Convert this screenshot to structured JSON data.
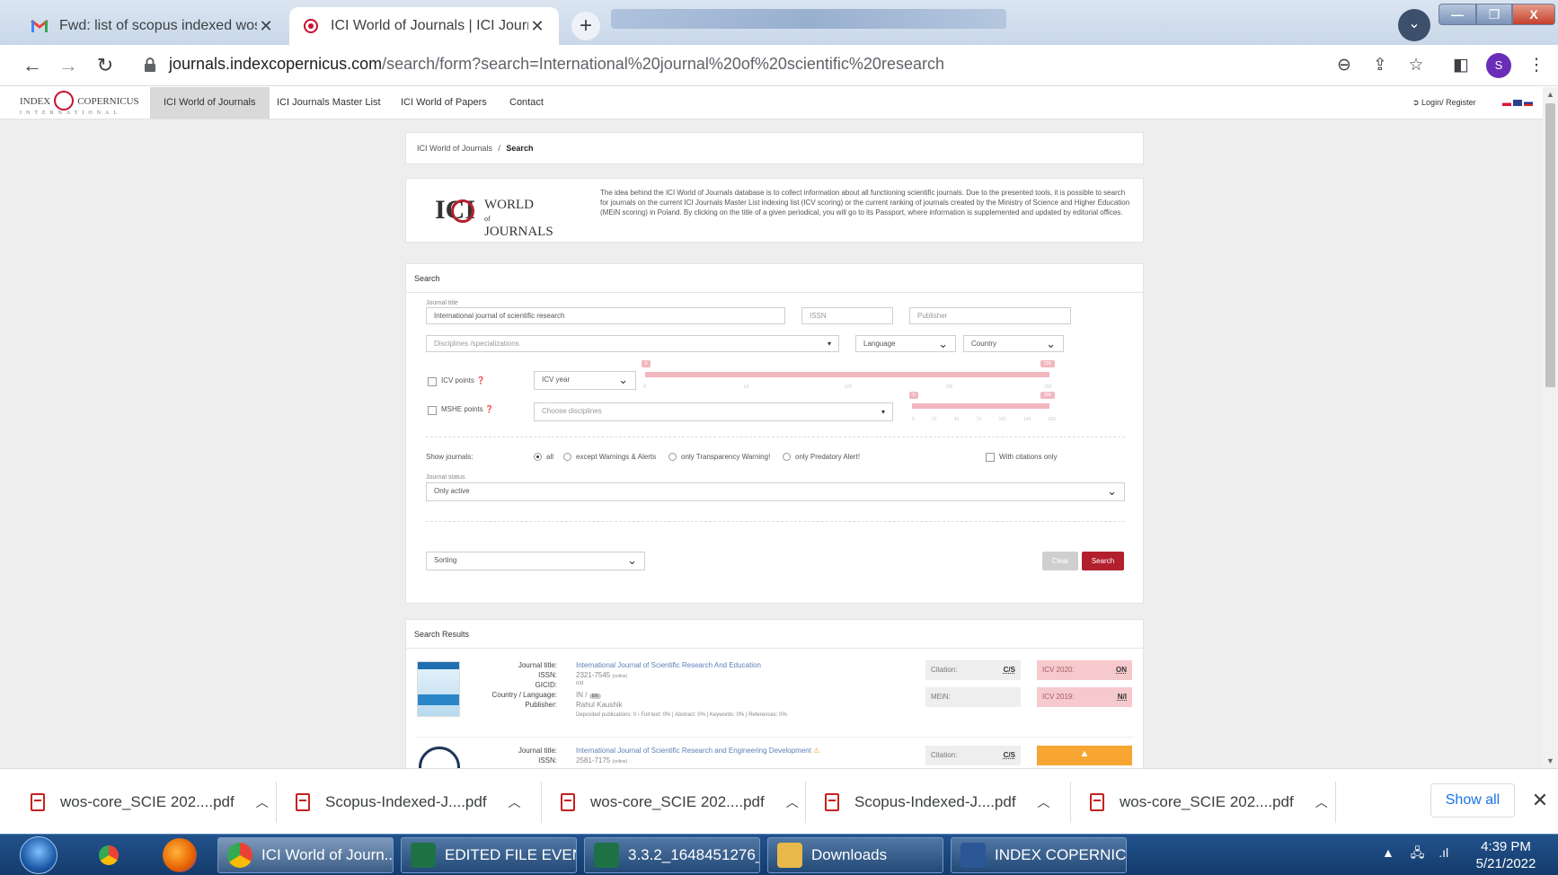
{
  "browser": {
    "tabs": [
      {
        "title": "Fwd: list of scopus indexed wos a",
        "favicon": "gmail-icon"
      },
      {
        "title": "ICI World of Journals | ICI Journal",
        "favicon": "ici-icon"
      }
    ],
    "url_host": "journals.indexcopernicus.com",
    "url_path": "/search/form?search=International%20journal%20of%20scientific%20research",
    "profile_initial": "S",
    "window_buttons": {
      "minimize": "—",
      "maximize": "❐",
      "close": "X"
    }
  },
  "site": {
    "logo": {
      "left": "INDEX",
      "right": "COPERNICUS",
      "sub": "INTERNATIONAL"
    },
    "nav": [
      "ICI World of Journals",
      "ICI Journals Master List",
      "ICI World of Papers",
      "Contact"
    ],
    "login": "Login/ Register",
    "breadcrumb": {
      "root": "ICI World of Journals",
      "sep": "/",
      "current": "Search"
    },
    "about": {
      "logo_ici": "ICI",
      "logo_words": [
        "WORLD",
        "of",
        "JOURNALS"
      ],
      "text": "The idea behind the ICI World of Journals database is to collect information about all functioning scientific journals. Due to the presented tools, it is possible to search for journals on the current ICI Journals Master List indexing list (ICV scoring) or the current ranking of journals created by the Ministry of Science and Higher Education (MEiN scoring) in Poland. By clicking on the title of a given periodical, you will go to its Passport, where information is supplemented and updated by editorial offices."
    }
  },
  "search": {
    "heading": "Search",
    "journal_title_label": "Journal title",
    "journal_title_value": "International journal of scientific research",
    "issn_placeholder": "ISSN",
    "publisher_placeholder": "Publisher",
    "disciplines_placeholder": "Disciplines /specializations",
    "language": "Language",
    "country": "Country",
    "icv_points_label": "ICV points",
    "icv_year": "ICV year",
    "icv_slider": {
      "min_label": "0",
      "max_label": "200",
      "ticks": [
        "0",
        "63",
        "125",
        "188",
        "250"
      ]
    },
    "mshe_points_label": "MSHE points",
    "choose_disciplines": "Choose disciplines",
    "mshe_slider": {
      "min_label": "0",
      "max_label": "200",
      "ticks": [
        "0",
        "20",
        "40",
        "70",
        "100",
        "140",
        "200"
      ]
    },
    "show_journals_label": "Show journals:",
    "show_options": [
      "all",
      "except Warnings & Alerts",
      "only Transparency Warning!",
      "only Predatory Alert!"
    ],
    "show_selected": "all",
    "with_citations": "With citations only",
    "journal_status_label": "Journal status",
    "journal_status": "Only active",
    "sorting": "Sorting",
    "clear": "Clear",
    "search_btn": "Search"
  },
  "results": {
    "heading": "Search Results",
    "labels": {
      "title": "Journal title:",
      "issn": "ISSN:",
      "gicid": "GICID:",
      "country": "Country / Language:",
      "publisher": "Publisher:"
    },
    "items": [
      {
        "title": "International Journal of Scientific Research And Education",
        "issn": "2321-7545",
        "issn_type": "(online)",
        "gicid": "n/d",
        "country": "IN /",
        "language": "EN",
        "publisher": "Rahul Kaushik",
        "deposited": "Deposited publications: 0 › Full text: 0% | Abstract: 0% | Keywords: 0% | References: 0%",
        "citation_label": "Citation:",
        "citation": "C/S",
        "mein_label": "MEiN:",
        "icv2020_label": "ICV 2020:",
        "icv2020": "ON",
        "icv2019_label": "ICV 2019:",
        "icv2019": "N/I"
      },
      {
        "title": "International Journal of Scientific Research and Engineering Development",
        "warning": "⚠",
        "issn": "2581-7175",
        "issn_type": "(online)",
        "citation_label": "Citation:",
        "citation": "C/S",
        "alert_icon": "▲"
      }
    ]
  },
  "downloads": {
    "items": [
      "wos-core_SCIE 202....pdf",
      "Scopus-Indexed-J....pdf",
      "wos-core_SCIE 202....pdf",
      "Scopus-Indexed-J....pdf",
      "wos-core_SCIE 202....pdf"
    ],
    "show_all": "Show all"
  },
  "taskbar": {
    "windows": [
      "ICI World of Journ...",
      "EDITED FILE EVEN...",
      "3.3.2_1648451276_...",
      "Downloads",
      "INDEX COPERNIC..."
    ],
    "time": "4:39 PM",
    "date": "5/21/2022"
  },
  "colors": {
    "accent": "#b21f2d",
    "slider": "#f2b7bf",
    "alert": "#f7a533",
    "taskbar": "#1c4a80"
  }
}
